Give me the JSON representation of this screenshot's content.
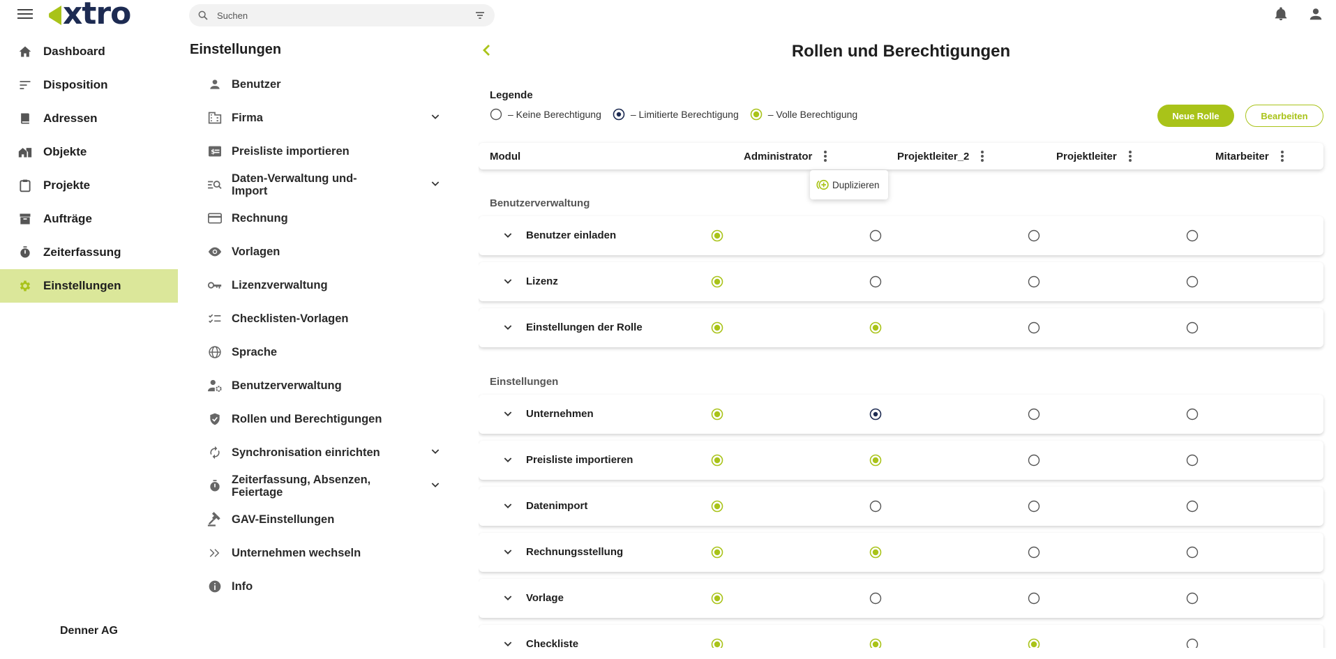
{
  "app": {
    "logo": "xtro",
    "search_placeholder": "Suchen"
  },
  "colors": {
    "accent": "#a9c319",
    "dark": "#1d2b52",
    "active_bg": "#dbe79a"
  },
  "sidebar": {
    "items": [
      {
        "label": "Dashboard",
        "icon": "home-icon"
      },
      {
        "label": "Disposition",
        "icon": "sort-lines-icon"
      },
      {
        "label": "Adressen",
        "icon": "book-icon"
      },
      {
        "label": "Objekte",
        "icon": "building-icon"
      },
      {
        "label": "Projekte",
        "icon": "clipboard-icon"
      },
      {
        "label": "Aufträge",
        "icon": "archive-icon"
      },
      {
        "label": "Zeiterfassung",
        "icon": "timer-icon"
      },
      {
        "label": "Einstellungen",
        "icon": "gear-icon",
        "active": true
      }
    ],
    "company": "Denner AG"
  },
  "settings": {
    "title": "Einstellungen",
    "items": [
      {
        "label": "Benutzer",
        "icon": "person-icon"
      },
      {
        "label": "Firma",
        "icon": "company-icon",
        "expandable": true
      },
      {
        "label": "Preisliste importieren",
        "icon": "price-icon"
      },
      {
        "label": "Daten-Verwaltung und-Import",
        "icon": "data-search-icon",
        "expandable": true
      },
      {
        "label": "Rechnung",
        "icon": "card-icon"
      },
      {
        "label": "Vorlagen",
        "icon": "eye-icon"
      },
      {
        "label": "Lizenzverwaltung",
        "icon": "key-icon"
      },
      {
        "label": "Checklisten-Vorlagen",
        "icon": "checklist-icon"
      },
      {
        "label": "Sprache",
        "icon": "globe-icon"
      },
      {
        "label": "Benutzerverwaltung",
        "icon": "user-gear-icon"
      },
      {
        "label": "Rollen und Berechtigungen",
        "icon": "shield-icon"
      },
      {
        "label": "Synchronisation einrichten",
        "icon": "sync-icon",
        "expandable": true
      },
      {
        "label": "Zeiterfassung, Absenzen, Feiertage",
        "icon": "timer-icon",
        "expandable": true
      },
      {
        "label": "GAV-Einstellungen",
        "icon": "gavel-icon"
      },
      {
        "label": "Unternehmen wechseln",
        "icon": "double-chevron-icon"
      },
      {
        "label": "Info",
        "icon": "info-icon"
      }
    ]
  },
  "main": {
    "title": "Rollen und Berechtigungen",
    "legend": {
      "title": "Legende",
      "none": "–  Keine Berechtigung",
      "limited": "–  Limitierte Berechtigung",
      "full": "–  Volle Berechtigung"
    },
    "buttons": {
      "new_role": "Neue Rolle",
      "edit": "Bearbeiten"
    },
    "columns": {
      "module": "Modul",
      "roles": [
        "Administrator",
        "Projektleiter_2",
        "Projektleiter",
        "Mitarbeiter"
      ]
    },
    "popup": {
      "duplicate": "Duplizieren"
    },
    "sections": [
      {
        "title": "Benutzerverwaltung",
        "rows": [
          {
            "name": "Benutzer einladen",
            "perms": [
              "full",
              "none",
              "none",
              "none"
            ]
          },
          {
            "name": "Lizenz",
            "perms": [
              "full",
              "none",
              "none",
              "none"
            ]
          },
          {
            "name": "Einstellungen der Rolle",
            "perms": [
              "full",
              "full",
              "none",
              "none"
            ]
          }
        ]
      },
      {
        "title": "Einstellungen",
        "rows": [
          {
            "name": "Unternehmen",
            "perms": [
              "full",
              "limited",
              "none",
              "none"
            ]
          },
          {
            "name": "Preisliste importieren",
            "perms": [
              "full",
              "full",
              "none",
              "none"
            ]
          },
          {
            "name": "Datenimport",
            "perms": [
              "full",
              "none",
              "none",
              "none"
            ]
          },
          {
            "name": "Rechnungsstellung",
            "perms": [
              "full",
              "full",
              "none",
              "none"
            ]
          },
          {
            "name": "Vorlage",
            "perms": [
              "full",
              "none",
              "none",
              "none"
            ]
          },
          {
            "name": "Checkliste",
            "perms": [
              "full",
              "full",
              "full",
              "none"
            ]
          }
        ]
      }
    ]
  }
}
